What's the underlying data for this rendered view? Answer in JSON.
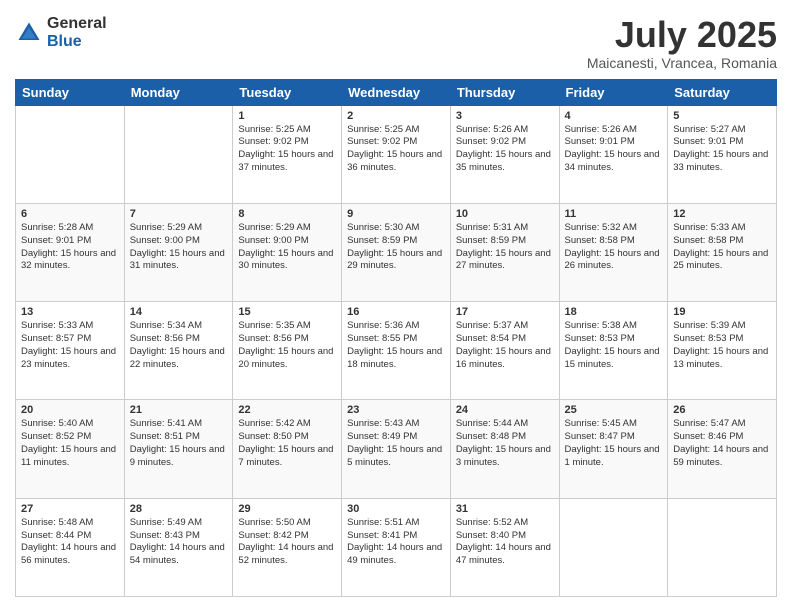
{
  "logo": {
    "general": "General",
    "blue": "Blue"
  },
  "header": {
    "title": "July 2025",
    "subtitle": "Maicanesti, Vrancea, Romania"
  },
  "days": [
    "Sunday",
    "Monday",
    "Tuesday",
    "Wednesday",
    "Thursday",
    "Friday",
    "Saturday"
  ],
  "weeks": [
    [
      {
        "day": "",
        "content": ""
      },
      {
        "day": "",
        "content": ""
      },
      {
        "day": "1",
        "content": "Sunrise: 5:25 AM\nSunset: 9:02 PM\nDaylight: 15 hours and 37 minutes."
      },
      {
        "day": "2",
        "content": "Sunrise: 5:25 AM\nSunset: 9:02 PM\nDaylight: 15 hours and 36 minutes."
      },
      {
        "day": "3",
        "content": "Sunrise: 5:26 AM\nSunset: 9:02 PM\nDaylight: 15 hours and 35 minutes."
      },
      {
        "day": "4",
        "content": "Sunrise: 5:26 AM\nSunset: 9:01 PM\nDaylight: 15 hours and 34 minutes."
      },
      {
        "day": "5",
        "content": "Sunrise: 5:27 AM\nSunset: 9:01 PM\nDaylight: 15 hours and 33 minutes."
      }
    ],
    [
      {
        "day": "6",
        "content": "Sunrise: 5:28 AM\nSunset: 9:01 PM\nDaylight: 15 hours and 32 minutes."
      },
      {
        "day": "7",
        "content": "Sunrise: 5:29 AM\nSunset: 9:00 PM\nDaylight: 15 hours and 31 minutes."
      },
      {
        "day": "8",
        "content": "Sunrise: 5:29 AM\nSunset: 9:00 PM\nDaylight: 15 hours and 30 minutes."
      },
      {
        "day": "9",
        "content": "Sunrise: 5:30 AM\nSunset: 8:59 PM\nDaylight: 15 hours and 29 minutes."
      },
      {
        "day": "10",
        "content": "Sunrise: 5:31 AM\nSunset: 8:59 PM\nDaylight: 15 hours and 27 minutes."
      },
      {
        "day": "11",
        "content": "Sunrise: 5:32 AM\nSunset: 8:58 PM\nDaylight: 15 hours and 26 minutes."
      },
      {
        "day": "12",
        "content": "Sunrise: 5:33 AM\nSunset: 8:58 PM\nDaylight: 15 hours and 25 minutes."
      }
    ],
    [
      {
        "day": "13",
        "content": "Sunrise: 5:33 AM\nSunset: 8:57 PM\nDaylight: 15 hours and 23 minutes."
      },
      {
        "day": "14",
        "content": "Sunrise: 5:34 AM\nSunset: 8:56 PM\nDaylight: 15 hours and 22 minutes."
      },
      {
        "day": "15",
        "content": "Sunrise: 5:35 AM\nSunset: 8:56 PM\nDaylight: 15 hours and 20 minutes."
      },
      {
        "day": "16",
        "content": "Sunrise: 5:36 AM\nSunset: 8:55 PM\nDaylight: 15 hours and 18 minutes."
      },
      {
        "day": "17",
        "content": "Sunrise: 5:37 AM\nSunset: 8:54 PM\nDaylight: 15 hours and 16 minutes."
      },
      {
        "day": "18",
        "content": "Sunrise: 5:38 AM\nSunset: 8:53 PM\nDaylight: 15 hours and 15 minutes."
      },
      {
        "day": "19",
        "content": "Sunrise: 5:39 AM\nSunset: 8:53 PM\nDaylight: 15 hours and 13 minutes."
      }
    ],
    [
      {
        "day": "20",
        "content": "Sunrise: 5:40 AM\nSunset: 8:52 PM\nDaylight: 15 hours and 11 minutes."
      },
      {
        "day": "21",
        "content": "Sunrise: 5:41 AM\nSunset: 8:51 PM\nDaylight: 15 hours and 9 minutes."
      },
      {
        "day": "22",
        "content": "Sunrise: 5:42 AM\nSunset: 8:50 PM\nDaylight: 15 hours and 7 minutes."
      },
      {
        "day": "23",
        "content": "Sunrise: 5:43 AM\nSunset: 8:49 PM\nDaylight: 15 hours and 5 minutes."
      },
      {
        "day": "24",
        "content": "Sunrise: 5:44 AM\nSunset: 8:48 PM\nDaylight: 15 hours and 3 minutes."
      },
      {
        "day": "25",
        "content": "Sunrise: 5:45 AM\nSunset: 8:47 PM\nDaylight: 15 hours and 1 minute."
      },
      {
        "day": "26",
        "content": "Sunrise: 5:47 AM\nSunset: 8:46 PM\nDaylight: 14 hours and 59 minutes."
      }
    ],
    [
      {
        "day": "27",
        "content": "Sunrise: 5:48 AM\nSunset: 8:44 PM\nDaylight: 14 hours and 56 minutes."
      },
      {
        "day": "28",
        "content": "Sunrise: 5:49 AM\nSunset: 8:43 PM\nDaylight: 14 hours and 54 minutes."
      },
      {
        "day": "29",
        "content": "Sunrise: 5:50 AM\nSunset: 8:42 PM\nDaylight: 14 hours and 52 minutes."
      },
      {
        "day": "30",
        "content": "Sunrise: 5:51 AM\nSunset: 8:41 PM\nDaylight: 14 hours and 49 minutes."
      },
      {
        "day": "31",
        "content": "Sunrise: 5:52 AM\nSunset: 8:40 PM\nDaylight: 14 hours and 47 minutes."
      },
      {
        "day": "",
        "content": ""
      },
      {
        "day": "",
        "content": ""
      }
    ]
  ]
}
